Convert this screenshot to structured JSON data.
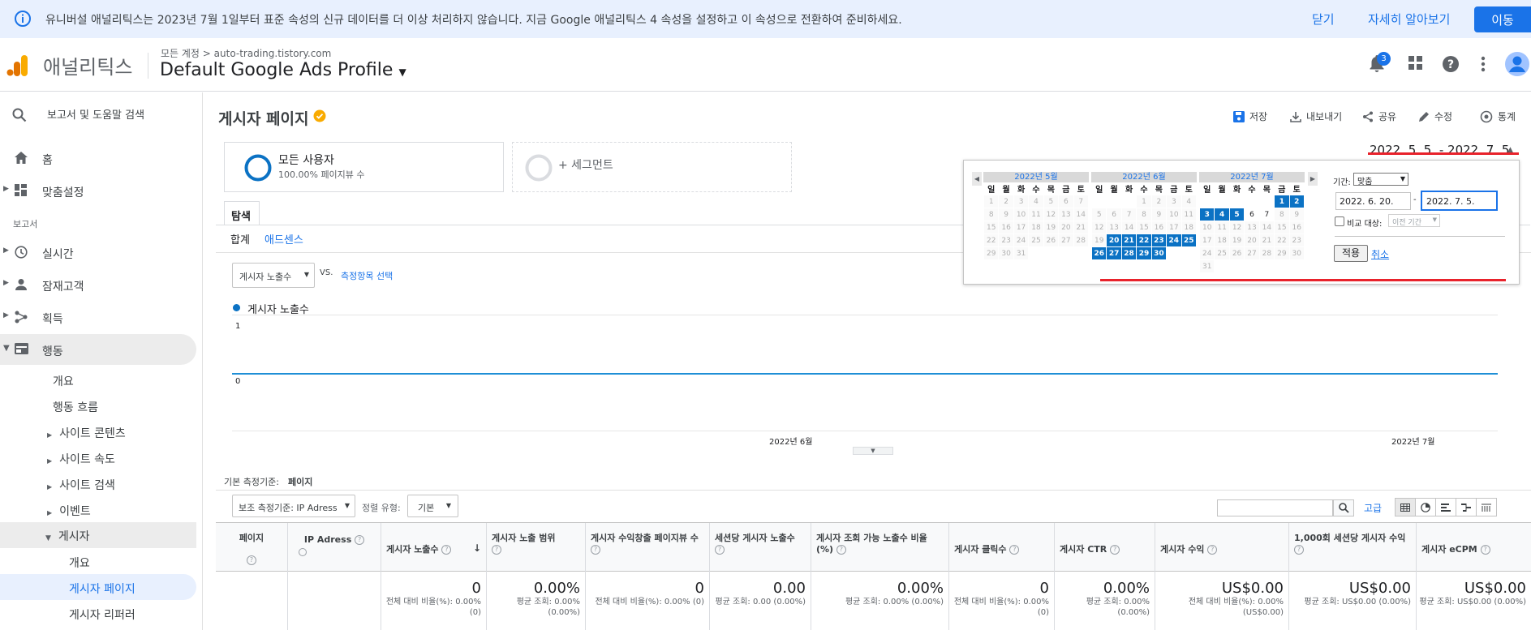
{
  "banner": {
    "text": "유니버설 애널리틱스는 2023년 7월 1일부터 표준 속성의 신규 데이터를 더 이상 처리하지 않습니다. 지금 Google 애널리틱스 4 속성을 설정하고 이 속성으로 전환하여 준비하세요.",
    "close_label": "닫기",
    "learn_more_label": "자세히 알아보기",
    "move_label": "이동"
  },
  "header": {
    "app_name": "애널리틱스",
    "breadcrumb_account": "모든 계정",
    "breadcrumb_property": "auto-trading.tistory.com",
    "profile_name": "Default Google Ads Profile",
    "notification_count": "3"
  },
  "sidebar": {
    "search_placeholder": "보고서 및 도움말 검색",
    "home_label": "홈",
    "custom_label": "맞춤설정",
    "section_reports": "보고서",
    "items": [
      {
        "label": "실시간"
      },
      {
        "label": "잠재고객"
      },
      {
        "label": "획득"
      },
      {
        "label": "행동"
      }
    ],
    "behavior_sub": [
      "개요",
      "행동 흐름",
      "사이트 콘텐츠",
      "사이트 속도",
      "사이트 검색",
      "이벤트",
      "게시자"
    ],
    "publisher_sub": [
      "개요",
      "게시자 페이지",
      "게시자 리퍼러"
    ]
  },
  "main": {
    "page_title": "게시자 페이지",
    "actions": {
      "save": "저장",
      "export": "내보내기",
      "share": "공유",
      "edit": "수정",
      "insights": "통계"
    },
    "segment_all_users": "모든 사용자",
    "segment_all_users_sub": "100.00% 페이지뷰 수",
    "segment_add": "+ 세그먼트",
    "date_range": "2022. 5. 5. - 2022. 7. 5.",
    "explorer_tab": "탐색",
    "subtab_summary": "합계",
    "subtab_adsense": "애드센스",
    "metric_select": "게시자 노출수",
    "vs_label": "VS.",
    "select_metric_link": "측정항목 선택",
    "legend_series": "게시자 노출수",
    "y_top": "1",
    "y_bottom": "0",
    "x_labels": [
      "2022년 6월",
      "2022년 7월"
    ],
    "primary_dimension_label": "기본 측정기준:",
    "primary_dimension_value": "페이지",
    "secondary_dimension": "보조 측정기준: IP Adress",
    "sort_type_label": "정렬 유형:",
    "sort_type_value": "기본",
    "advanced_link": "고급"
  },
  "calendar": {
    "months": [
      {
        "title": "2022년 5월",
        "weeks": [
          [
            "1",
            "2",
            "3",
            "4",
            "5",
            "6",
            "7"
          ],
          [
            "8",
            "9",
            "10",
            "11",
            "12",
            "13",
            "14"
          ],
          [
            "15",
            "16",
            "17",
            "18",
            "19",
            "20",
            "21"
          ],
          [
            "22",
            "23",
            "24",
            "25",
            "26",
            "27",
            "28"
          ],
          [
            "29",
            "30",
            "31",
            "",
            "",
            "",
            ""
          ]
        ]
      },
      {
        "title": "2022년 6월",
        "weeks": [
          [
            "",
            "",
            "",
            "1",
            "2",
            "3",
            "4"
          ],
          [
            "5",
            "6",
            "7",
            "8",
            "9",
            "10",
            "11"
          ],
          [
            "12",
            "13",
            "14",
            "15",
            "16",
            "17",
            "18"
          ],
          [
            "19",
            "20",
            "21",
            "22",
            "23",
            "24",
            "25"
          ],
          [
            "26",
            "27",
            "28",
            "29",
            "30",
            "",
            ""
          ]
        ]
      },
      {
        "title": "2022년 7월",
        "weeks": [
          [
            "",
            "",
            "",
            "",
            "",
            "1",
            "2"
          ],
          [
            "3",
            "4",
            "5",
            "6",
            "7",
            "8",
            "9"
          ],
          [
            "10",
            "11",
            "12",
            "13",
            "14",
            "15",
            "16"
          ],
          [
            "17",
            "18",
            "19",
            "20",
            "21",
            "22",
            "23"
          ],
          [
            "24",
            "25",
            "26",
            "27",
            "28",
            "29",
            "30"
          ],
          [
            "31",
            "",
            "",
            "",
            "",
            "",
            ""
          ]
        ]
      }
    ],
    "weekdays": [
      "일",
      "월",
      "화",
      "수",
      "목",
      "금",
      "토"
    ],
    "period_label": "기간:",
    "period_value": "맞춤",
    "start_date": "2022. 6. 20.",
    "dash": "-",
    "end_date": "2022. 7. 5.",
    "compare_label": "비교 대상:",
    "compare_value": "이전 기간",
    "apply_label": "적용",
    "cancel_label": "취소"
  },
  "table": {
    "headers": [
      "페이지",
      "IP Adress",
      "게시자 노출수",
      "게시자 노출 범위",
      "게시자 수익창출 페이지뷰 수",
      "세션당 게시자 노출수",
      "게시자 조회 가능 노출수 비율 (%)",
      "게시자 클릭수",
      "게시자 CTR",
      "게시자 수익",
      "1,000회 세션당 게시자 수익",
      "게시자 eCPM"
    ],
    "totals": [
      {
        "value": "0",
        "sub": "전체 대비 비율(%): 0.00% (0)"
      },
      {
        "value": "0.00%",
        "sub": "평균 조회: 0.00% (0.00%)"
      },
      {
        "value": "0",
        "sub": "전체 대비 비율(%): 0.00% (0)"
      },
      {
        "value": "0.00",
        "sub": "평균 조회: 0.00 (0.00%)"
      },
      {
        "value": "0.00%",
        "sub": "평균 조회: 0.00% (0.00%)"
      },
      {
        "value": "0",
        "sub": "전체 대비 비율(%): 0.00% (0)"
      },
      {
        "value": "0.00%",
        "sub": "평균 조회: 0.00% (0.00%)"
      },
      {
        "value": "US$0.00",
        "sub": "전체 대비 비율(%): 0.00% (US$0.00)"
      },
      {
        "value": "US$0.00",
        "sub": "평균 조회: US$0.00 (0.00%)"
      },
      {
        "value": "US$0.00",
        "sub": "평균 조회: US$0.00 (0.00%)"
      }
    ]
  },
  "colors": {
    "accent": "#1a73e8",
    "selected_day": "#0b72c4",
    "annotation_red": "#e8222b",
    "logo_orange": "#f9ab00",
    "logo_dark": "#e37400"
  }
}
